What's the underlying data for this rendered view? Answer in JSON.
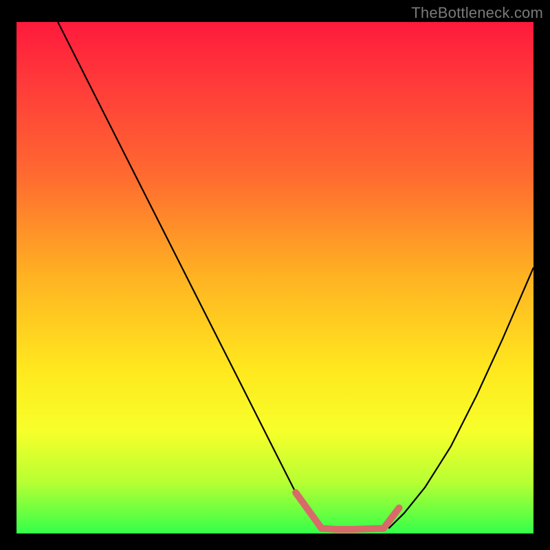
{
  "watermark": "TheBottleneck.com",
  "chart_data": {
    "type": "line",
    "title": "",
    "xlabel": "",
    "ylabel": "",
    "xlim": [
      0,
      100
    ],
    "ylim": [
      0,
      100
    ],
    "legend": false,
    "grid": false,
    "background_gradient": {
      "top": "#ff1a3c",
      "bottom": "#34ff4a"
    },
    "series": [
      {
        "name": "left-branch-curve",
        "color": "#000000",
        "x": [
          8,
          15,
          22,
          29,
          36,
          43,
          50,
          54,
          57,
          59
        ],
        "values": [
          100,
          86,
          72,
          58,
          44,
          30,
          16,
          8,
          3,
          1
        ]
      },
      {
        "name": "right-branch-curve",
        "color": "#000000",
        "x": [
          72,
          75,
          79,
          84,
          89,
          94,
          100
        ],
        "values": [
          1,
          4,
          9,
          17,
          27,
          38,
          52
        ]
      },
      {
        "name": "bottom-dash-left",
        "color": "#d86a6a",
        "x": [
          54,
          59
        ],
        "values": [
          8,
          1
        ]
      },
      {
        "name": "bottom-dash-flat",
        "color": "#d86a6a",
        "x": [
          59,
          62,
          65,
          68,
          71
        ],
        "values": [
          1,
          0.8,
          0.8,
          0.9,
          1
        ]
      },
      {
        "name": "bottom-dash-right",
        "color": "#d86a6a",
        "x": [
          71,
          74
        ],
        "values": [
          1,
          5
        ]
      }
    ]
  }
}
